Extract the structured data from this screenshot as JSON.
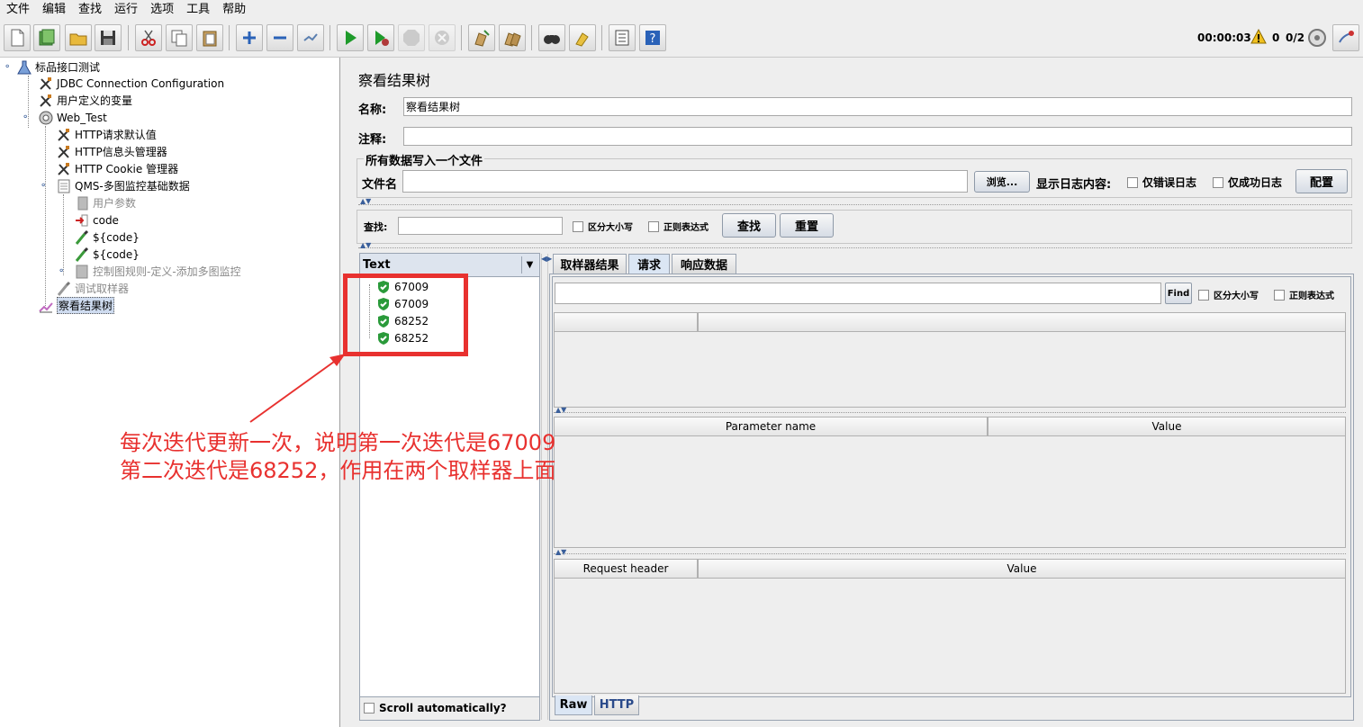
{
  "menu": [
    "文件",
    "编辑",
    "查找",
    "运行",
    "选项",
    "工具",
    "帮助"
  ],
  "toolbar_status": {
    "timer": "00:00:03",
    "warnings": "0",
    "threads": "0/2"
  },
  "tree": {
    "root": "标品接口测试",
    "jdbc": "JDBC Connection Configuration",
    "user_vars": "用户定义的变量",
    "thread_group": "Web_Test",
    "http_defaults": "HTTP请求默认值",
    "http_header": "HTTP信息头管理器",
    "http_cookie": "HTTP Cookie 管理器",
    "qms": "QMS-多图监控基础数据",
    "user_params": "用户参数",
    "code": "code",
    "code_var1": "${code}",
    "code_var2": "${code}",
    "control_rule": "控制图规则-定义-添加多图监控",
    "debug_sampler": "调试取样器",
    "view_tree": "察看结果树"
  },
  "panel": {
    "title": "察看结果树",
    "name_label": "名称:",
    "name_value": "察看结果树",
    "comment_label": "注释:",
    "comment_value": "",
    "file_group": "所有数据写入一个文件",
    "filename_label": "文件名",
    "filename_value": "",
    "browse_btn": "浏览...",
    "log_label": "显示日志内容:",
    "errors_only": "仅错误日志",
    "success_only": "仅成功日志",
    "config_btn": "配置",
    "search_label": "查找:",
    "search_value": "",
    "case_sensitive": "区分大小写",
    "regex": "正则表达式",
    "find_btn": "查找",
    "reset_btn": "重置"
  },
  "results": {
    "renderer": "Text",
    "items": [
      "67009",
      "67009",
      "68252",
      "68252"
    ],
    "scroll_auto": "Scroll automatically?"
  },
  "detail": {
    "tabs": [
      "取样器结果",
      "请求",
      "响应数据"
    ],
    "active_tab": "请求",
    "find_btn": "Find",
    "case_sensitive": "区分大小写",
    "regex": "正则表达式",
    "param_name": "Parameter name",
    "param_value": "Value",
    "header_name": "Request header",
    "header_value": "Value",
    "bottom_tabs": [
      "Raw",
      "HTTP"
    ]
  },
  "annotation": {
    "line1": "每次迭代更新一次，说明第一次迭代是67009",
    "line2": "第二次迭代是68252，作用在两个取样器上面",
    "color": "#e8312f"
  }
}
